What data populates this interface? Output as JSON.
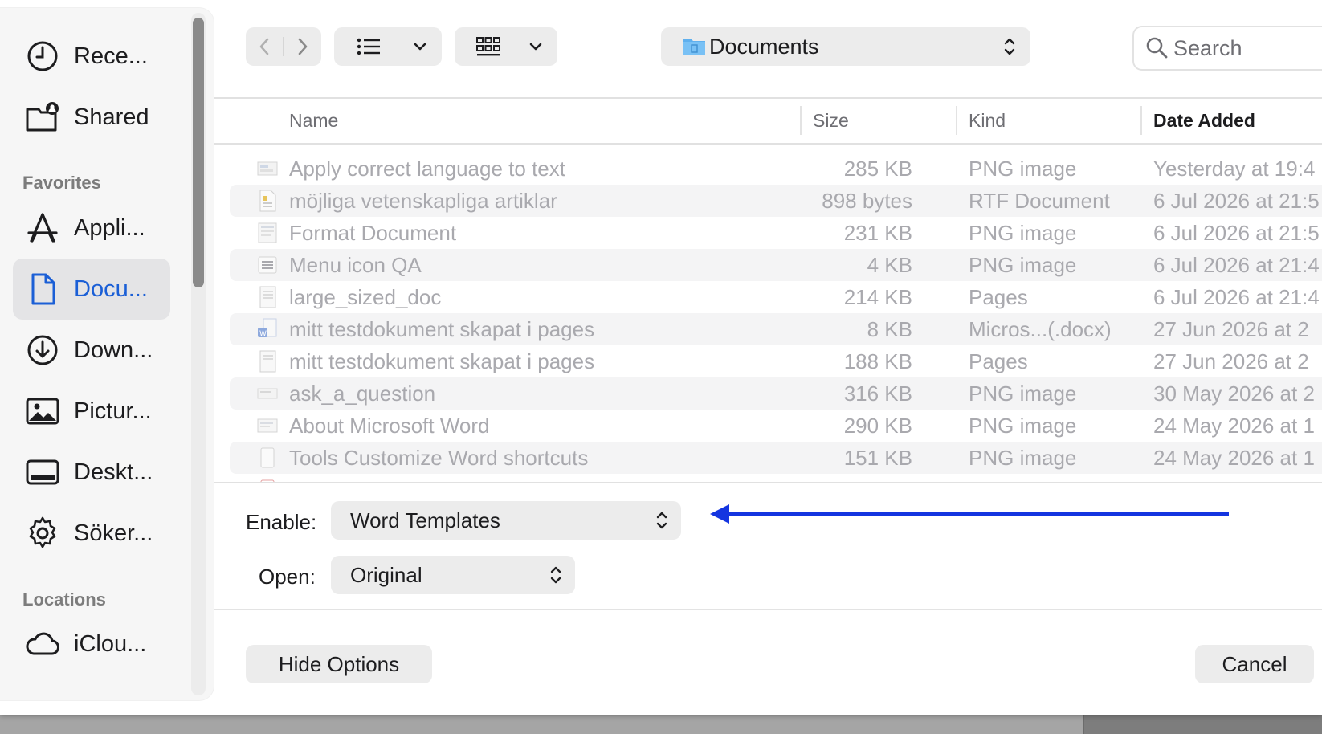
{
  "sidebar": {
    "items_top": [
      {
        "label": "Rece...",
        "icon": "clock-icon"
      },
      {
        "label": "Shared",
        "icon": "shared-folder-icon"
      }
    ],
    "favorites_header": "Favorites",
    "favorites": [
      {
        "label": "Appli...",
        "icon": "applications-icon"
      },
      {
        "label": "Docu...",
        "icon": "document-icon",
        "active": true
      },
      {
        "label": "Down...",
        "icon": "download-icon"
      },
      {
        "label": "Pictur...",
        "icon": "photo-icon"
      },
      {
        "label": "Deskt...",
        "icon": "desktop-icon"
      },
      {
        "label": "Söker...",
        "icon": "gear-icon"
      }
    ],
    "locations_header": "Locations",
    "locations": [
      {
        "label": "iClou...",
        "icon": "cloud-icon"
      }
    ]
  },
  "toolbar": {
    "location": "Documents",
    "search_placeholder": "Search"
  },
  "columns": {
    "name": "Name",
    "size": "Size",
    "kind": "Kind",
    "date": "Date Added"
  },
  "files": [
    {
      "name": "Apply correct language to text",
      "size": "285 KB",
      "kind": "PNG image",
      "date": "Yesterday at 19:4"
    },
    {
      "name": "möjliga vetenskapliga artiklar",
      "size": "898 bytes",
      "kind": "RTF Document",
      "date": "6 Jul 2026 at 21:5"
    },
    {
      "name": "Format Document",
      "size": "231 KB",
      "kind": "PNG image",
      "date": "6 Jul 2026 at 21:5"
    },
    {
      "name": "Menu icon QA",
      "size": "4 KB",
      "kind": "PNG image",
      "date": "6 Jul 2026 at 21:4"
    },
    {
      "name": "large_sized_doc",
      "size": "214 KB",
      "kind": "Pages",
      "date": "6 Jul 2026 at 21:4"
    },
    {
      "name": "mitt testdokument skapat i pages",
      "size": "8 KB",
      "kind": "Micros...(.docx)",
      "date": "27 Jun 2026 at 2"
    },
    {
      "name": "mitt testdokument skapat i pages",
      "size": "188 KB",
      "kind": "Pages",
      "date": "27 Jun 2026 at 2"
    },
    {
      "name": "ask_a_question",
      "size": "316 KB",
      "kind": "PNG image",
      "date": "30 May 2026 at 2"
    },
    {
      "name": "About Microsoft Word",
      "size": "290 KB",
      "kind": "PNG image",
      "date": "24 May 2026 at 1"
    },
    {
      "name": "Tools Customize Word shortcuts",
      "size": "151 KB",
      "kind": "PNG image",
      "date": "24 May 2026 at 1"
    }
  ],
  "options": {
    "enable_label": "Enable:",
    "enable_value": "Word Templates",
    "open_label": "Open:",
    "open_value": "Original"
  },
  "buttons": {
    "hide_options": "Hide Options",
    "cancel": "Cancel"
  },
  "colors": {
    "accent": "#1b5fd6",
    "annotation_arrow": "#1435e0"
  }
}
